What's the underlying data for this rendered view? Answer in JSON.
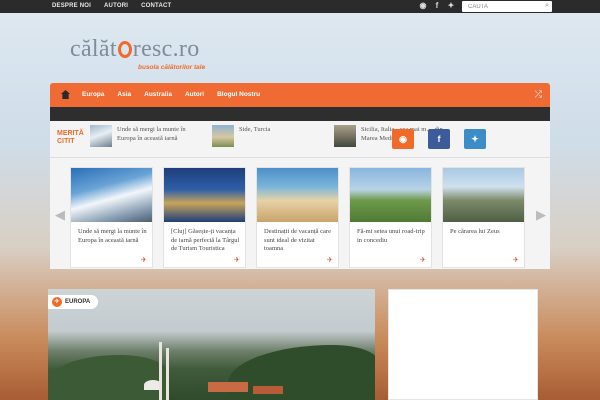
{
  "topbar": {
    "links": [
      "DESPRE NOI",
      "AUTORI",
      "CONTACT"
    ],
    "social_icons": [
      "rss-icon",
      "facebook-icon",
      "twitter-icon"
    ],
    "search_placeholder": "CAUTA"
  },
  "logo": {
    "name_left": "călăt",
    "name_right": "resc.ro",
    "tagline": "busola călătorilor tale"
  },
  "nav": {
    "items": [
      "Europa",
      "Asia",
      "Australia",
      "Autori",
      "Blogul Nostru"
    ]
  },
  "merita": {
    "label_line1": "MERITĂ",
    "label_line2": "CITIT",
    "items": [
      {
        "title": "Unde să mergi la munte în Europa în această iarnă"
      },
      {
        "title": "Side, Turcia"
      },
      {
        "title": "Sicilia, Italia - cea mai m… din Marea Mediterană"
      }
    ]
  },
  "share_tiles": [
    "rss-icon",
    "facebook-icon",
    "twitter-icon"
  ],
  "colors": {
    "accent": "#f06a34",
    "dark": "#2e2e2e",
    "rss": "#f06a2a",
    "facebook": "#3b5b9a",
    "twitter": "#3b8cc7"
  },
  "cards": [
    {
      "caption": "Unde să mergi la munte în Europa în această iarnă"
    },
    {
      "caption": "[Cluj] Găsește-ți vacanța de iarnă perfectă la Târgul de Turism Touristica"
    },
    {
      "caption": "Destinații de vacanță care sunt ideal de vizitat toamna"
    },
    {
      "caption": "Fă-mi setea unui road-trip in concediu"
    },
    {
      "caption": "Pe cărarea lui Zeus"
    }
  ],
  "featured": {
    "category": "EUROPA"
  }
}
